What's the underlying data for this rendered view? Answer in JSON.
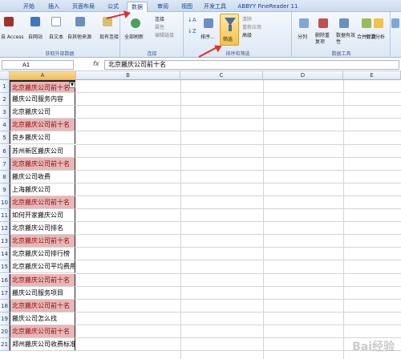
{
  "tabs": [
    "开始",
    "插入",
    "页面布局",
    "公式",
    "数据",
    "审阅",
    "视图",
    "开发工具",
    "ABBYY FineReader 11"
  ],
  "active_tab": "数据",
  "ribbon": {
    "ext_data": {
      "access": "自 Access",
      "web": "自网站",
      "text": "自文本",
      "other": "自其他来源",
      "existing": "现有连接",
      "label": "获取外部数据"
    },
    "conn": {
      "refresh": "全部刷新",
      "connections": "连接",
      "properties": "属性",
      "edit_links": "编辑链接",
      "label": "连接"
    },
    "sort": {
      "sort": "排序...",
      "filter": "筛选",
      "clear": "清除",
      "reapply": "重新应用",
      "advanced": "高级",
      "label": "排序和筛选"
    },
    "tools": {
      "split": "分列",
      "remove_dup": "删除重复项",
      "validation": "数据有效性",
      "consolidate": "合并计算",
      "whatif": "假设分析",
      "label": "数据工具"
    },
    "outline": {
      "group": "创建组"
    }
  },
  "formula_bar": {
    "cell_ref": "A1",
    "fx": "fx",
    "content": "北京搬庆公司前十名"
  },
  "columns": [
    "A",
    "B",
    "C",
    "D",
    "E"
  ],
  "rows": [
    {
      "num": "1",
      "text": "北京搬庆公司前十名",
      "hl": true
    },
    {
      "num": "2",
      "text": "搬庆公司服务内容",
      "hl": false
    },
    {
      "num": "3",
      "text": "北京搬庆公司",
      "hl": false
    },
    {
      "num": "4",
      "text": "北京搬庆公司前十名",
      "hl": true
    },
    {
      "num": "5",
      "text": "良乡搬庆公司",
      "hl": false
    },
    {
      "num": "6",
      "text": "苏州新区搬庆公司",
      "hl": false
    },
    {
      "num": "7",
      "text": "北京搬庆公司前十名",
      "hl": true
    },
    {
      "num": "8",
      "text": "搬庆公司收费",
      "hl": false
    },
    {
      "num": "9",
      "text": "上海搬庆公司",
      "hl": false
    },
    {
      "num": "10",
      "text": "北京搬庆公司前十名",
      "hl": true
    },
    {
      "num": "11",
      "text": "如何开家搬庆公司",
      "hl": false
    },
    {
      "num": "12",
      "text": "北京搬庆公司排名",
      "hl": false
    },
    {
      "num": "13",
      "text": "北京搬庆公司前十名",
      "hl": true
    },
    {
      "num": "14",
      "text": "北京搬庆公司排行榜",
      "hl": false
    },
    {
      "num": "15",
      "text": "北京搬庆公司平均费用",
      "hl": false
    },
    {
      "num": "16",
      "text": "北京搬庆公司前十名",
      "hl": true
    },
    {
      "num": "17",
      "text": "搬庆公司服务项目",
      "hl": false
    },
    {
      "num": "18",
      "text": "北京搬庆公司前十名",
      "hl": true
    },
    {
      "num": "19",
      "text": "搬庆公司怎么找",
      "hl": false
    },
    {
      "num": "20",
      "text": "北京搬庆公司前十名",
      "hl": true
    },
    {
      "num": "21",
      "text": "郑州搬庆公司收费标准",
      "hl": false
    }
  ],
  "watermark": "Bai经验",
  "colors": {
    "highlight_fill": "#e6b8b7",
    "highlight_text": "#9c0006",
    "annotation": "#e03030"
  }
}
